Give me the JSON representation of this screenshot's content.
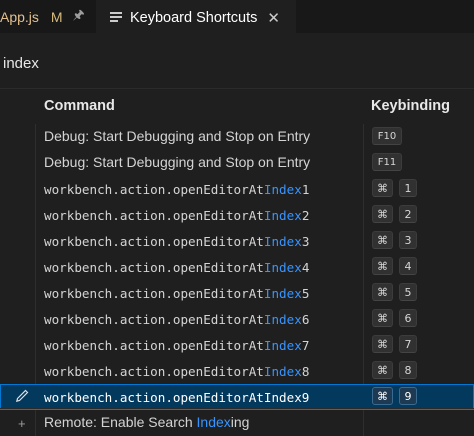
{
  "tabs": [
    {
      "name": "App.js",
      "modified": "M"
    },
    {
      "name": "Keyboard Shortcuts"
    }
  ],
  "search": {
    "value": "index"
  },
  "table": {
    "headers": {
      "command": "Command",
      "keybinding": "Keybinding"
    },
    "rows": [
      {
        "pre": "Debug: Start Debugging and Stop on Entry",
        "hl": "",
        "post": "",
        "keys": [
          "F10"
        ],
        "mono": false
      },
      {
        "pre": "Debug: Start Debugging and Stop on Entry",
        "hl": "",
        "post": "",
        "keys": [
          "F11"
        ],
        "mono": false
      },
      {
        "pre": "workbench.action.openEditorAt",
        "hl": "Index",
        "post": "1",
        "keys": [
          "⌘",
          "1"
        ],
        "mono": true
      },
      {
        "pre": "workbench.action.openEditorAt",
        "hl": "Index",
        "post": "2",
        "keys": [
          "⌘",
          "2"
        ],
        "mono": true
      },
      {
        "pre": "workbench.action.openEditorAt",
        "hl": "Index",
        "post": "3",
        "keys": [
          "⌘",
          "3"
        ],
        "mono": true
      },
      {
        "pre": "workbench.action.openEditorAt",
        "hl": "Index",
        "post": "4",
        "keys": [
          "⌘",
          "4"
        ],
        "mono": true
      },
      {
        "pre": "workbench.action.openEditorAt",
        "hl": "Index",
        "post": "5",
        "keys": [
          "⌘",
          "5"
        ],
        "mono": true
      },
      {
        "pre": "workbench.action.openEditorAt",
        "hl": "Index",
        "post": "6",
        "keys": [
          "⌘",
          "6"
        ],
        "mono": true
      },
      {
        "pre": "workbench.action.openEditorAt",
        "hl": "Index",
        "post": "7",
        "keys": [
          "⌘",
          "7"
        ],
        "mono": true
      },
      {
        "pre": "workbench.action.openEditorAt",
        "hl": "Index",
        "post": "8",
        "keys": [
          "⌘",
          "8"
        ],
        "mono": true
      },
      {
        "pre": "workbench.action.openEditorAtIndex9",
        "hl": "",
        "post": "",
        "keys": [
          "⌘",
          "9"
        ],
        "mono": true,
        "selected": true
      },
      {
        "pre": "Remote: Enable Search ",
        "hl": "Index",
        "post": "ing",
        "keys": [],
        "mono": false
      }
    ]
  },
  "icons": {
    "pin": "pin-icon",
    "close": "close-icon",
    "keyboard": "keyboard-icon",
    "edit": "pencil-icon",
    "add": "plus-icon"
  },
  "colors": {
    "highlight": "#3794ff",
    "selection": "#04395e",
    "modified": "#d7ba7d"
  }
}
